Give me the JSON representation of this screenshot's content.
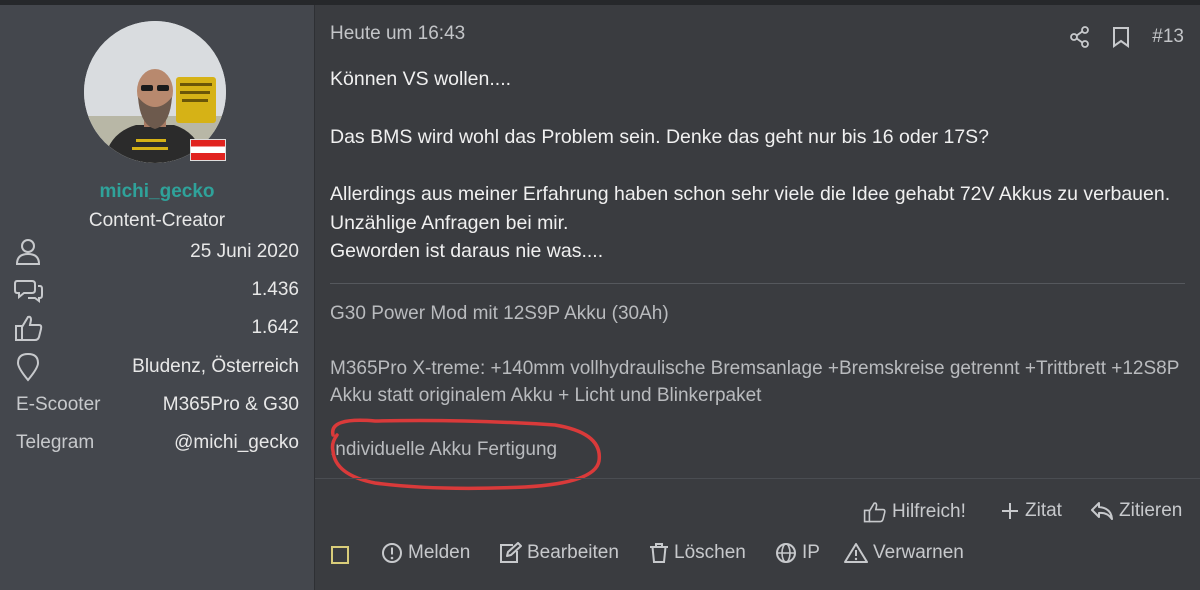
{
  "user": {
    "username": "michi_gecko",
    "role": "Content-Creator",
    "stats": {
      "joined": "25 Juni 2020",
      "messages": "1.436",
      "reactions": "1.642",
      "location": "Bludenz, Österreich",
      "escooter_label": "E-Scooter",
      "escooter_value": "M365Pro & G30",
      "telegram_label": "Telegram",
      "telegram_value": "@michi_gecko"
    },
    "flag_country": "Austria"
  },
  "post": {
    "time": "Heute um 16:43",
    "number": "#13",
    "lines": [
      "Können VS wollen....",
      "Das BMS wird wohl das Problem sein. Denke das geht nur bis 16 oder 17S?",
      "Allerdings aus meiner Erfahrung haben schon sehr viele die Idee gehabt 72V Akkus zu verbauen. Unzählige Anfragen bei mir.",
      "Geworden ist daraus nie was...."
    ]
  },
  "signature": {
    "line1": "G30 Power Mod mit 12S9P Akku (30Ah)",
    "line2": "M365Pro X-treme: +140mm vollhydraulische Bremsanlage +Bremskreise getrennt +Trittbrett +12S8P Akku statt originalem Akku + Licht und Blinkerpaket",
    "line3": "Individuelle Akku Fertigung"
  },
  "actions_top": {
    "helpful": "Hilfreich!",
    "quote": "Zitat",
    "reply": "Zitieren"
  },
  "actions_bottom": {
    "report": "Melden",
    "edit": "Bearbeiten",
    "delete": "Löschen",
    "ip": "IP",
    "warn": "Verwarnen"
  },
  "colors": {
    "username": "#2fa29a",
    "annotation": "#d93a3a",
    "checkbox": "#d9cd7a"
  },
  "icons": [
    "user-icon",
    "messages-icon",
    "thumbs-up-icon",
    "location-pin-icon",
    "share-icon",
    "bookmark-icon",
    "alert-circle-icon",
    "edit-icon",
    "trash-icon",
    "globe-icon",
    "warning-triangle-icon",
    "plus-icon",
    "reply-icon"
  ]
}
